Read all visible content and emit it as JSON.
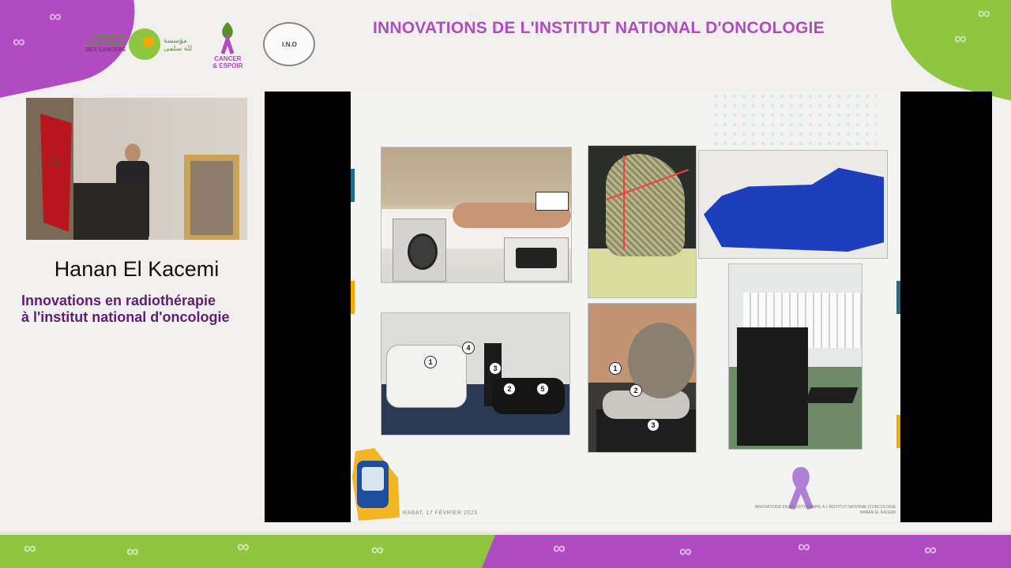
{
  "banner": {
    "title": "INNOVATIONS DE L'INSTITUT NATIONAL D'ONCOLOGIE",
    "logos": {
      "fondation_line1": "FONDATION",
      "fondation_line2": "LALLA SALMA",
      "fondation_line3": "DES CANCERS",
      "cancer_espoir_line1": "CANCER",
      "cancer_espoir_line2": "& ESPOIR",
      "ino": "I.N.O"
    },
    "colors": {
      "purple": "#b04bc1",
      "green": "#8ec63f"
    }
  },
  "speaker": {
    "name": "Hanan El Kacemi",
    "talk_title_line1": "Innovations en radiothérapie",
    "talk_title_line2": "à l'institut national d'oncologie"
  },
  "slide": {
    "footer_left": "RABAT, 17 FÉVRIER 2023",
    "footer_right_line1": "INNOVATIONS EN RADIOTHÉRAPIE À L'INSTITUT NATIONAL D'ONCOLOGIE",
    "footer_right_line2": "HANAN EL KACEMI",
    "markers": [
      "1",
      "2",
      "3",
      "4",
      "5"
    ]
  }
}
